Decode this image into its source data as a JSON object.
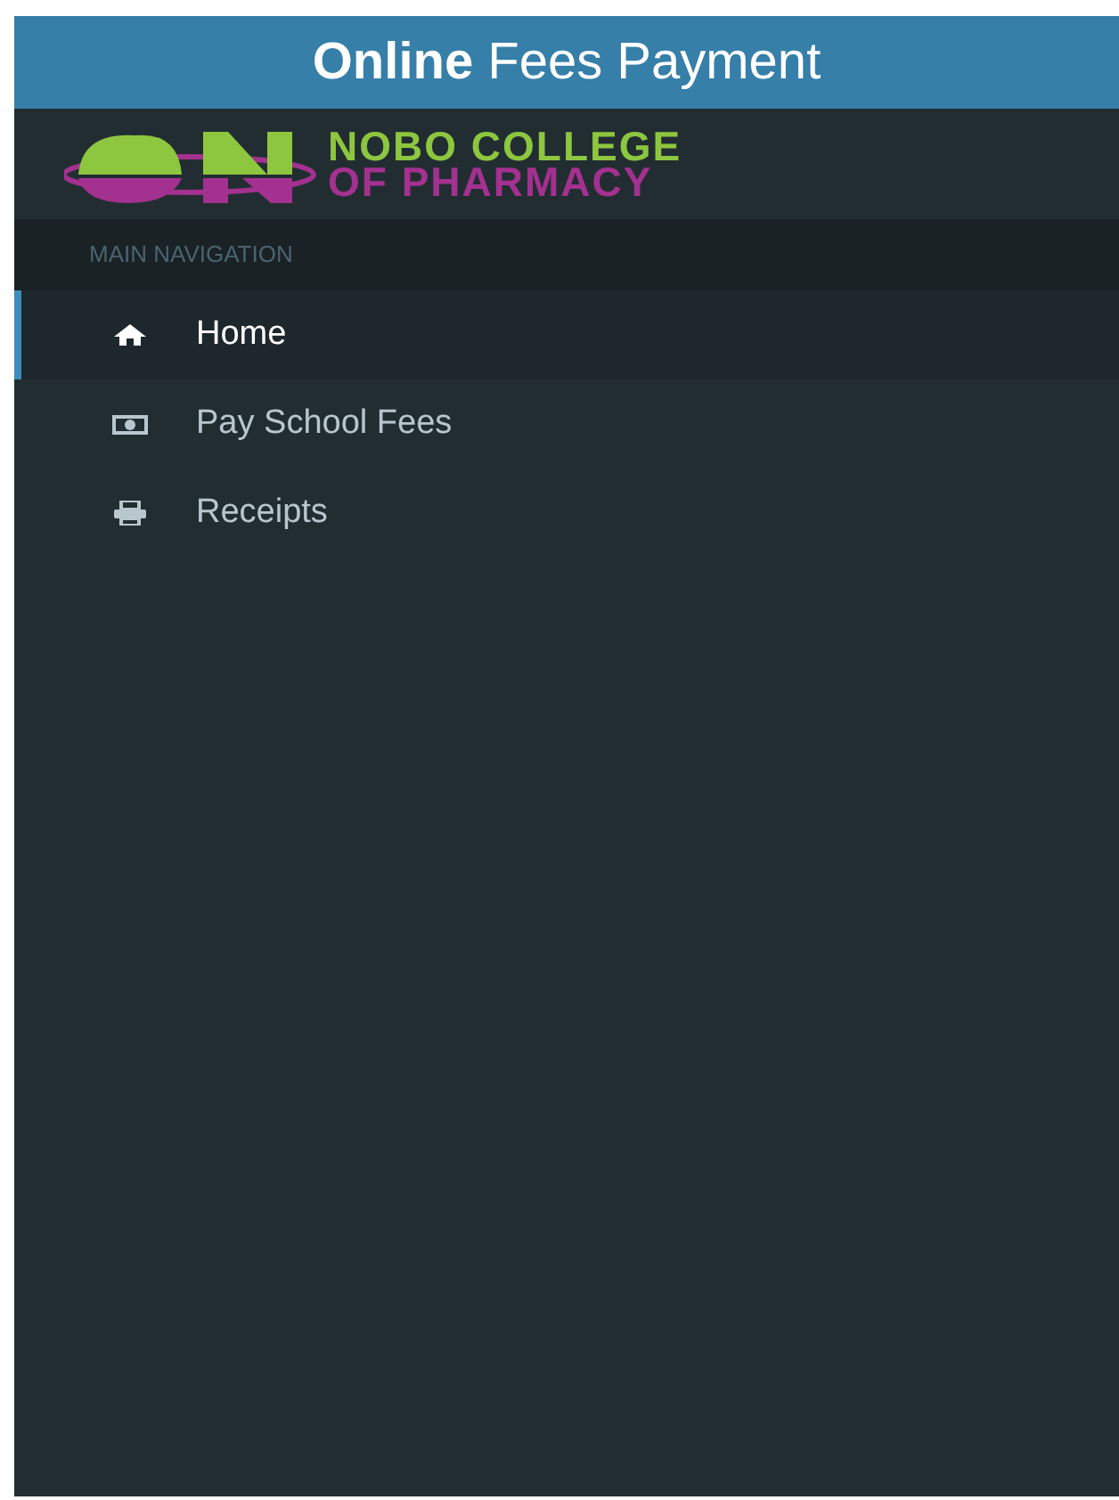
{
  "header": {
    "title": "**Online** Fees Payment"
  },
  "logo": {
    "line_1": "NOBO COLLEGE",
    "line_2": "OF PHARMACY"
  },
  "sidebar": {
    "heading": "MAIN NAVIGATION",
    "items": [
      {
        "label": "Home",
        "kind": "home",
        "selected": true
      },
      {
        "label": "Pay School Fees",
        "kind": "payment",
        "selected": false
      },
      {
        "label": "Receipts",
        "kind": "receipts",
        "selected": false
      }
    ]
  }
}
